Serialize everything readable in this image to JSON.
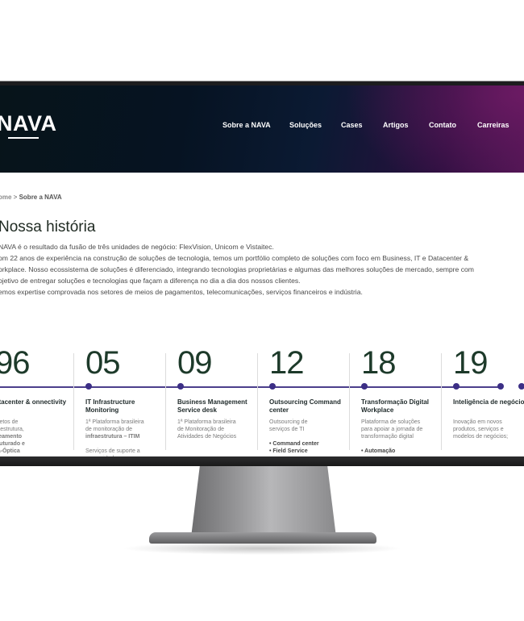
{
  "header": {
    "logo": "NAVA",
    "nav": [
      "Sobre a NAVA",
      "Soluções",
      "Cases",
      "Artigos",
      "Contato",
      "Carreiras"
    ]
  },
  "breadcrumb": {
    "home": "ome",
    "separator": " > ",
    "current": "Sobre a NAVA"
  },
  "page": {
    "title": "Nossa história",
    "intro": [
      "NAVA é o resultado da fusão de três unidades de negócio: FlexVision, Unicom e Vistaitec.",
      "om 22 anos de experiência na construção de soluções de tecnologia, temos um portfólio completo de soluções com foco em Business, IT e Datacenter &",
      "orkplace. Nosso ecossistema de soluções é diferenciado, integrando tecnologias proprietárias e algumas das melhores soluções de mercado, sempre com",
      "ojetivo de entregar soluções e tecnologias que façam a diferença no dia a dia dos nossos clientes.",
      "emos expertise comprovada nos setores de meios de pagamentos, telecomunicações, serviços financeiros e indústria."
    ]
  },
  "timeline": [
    {
      "year": "96",
      "title": "atacenter & onnectivity",
      "desc": [
        "ojetos de",
        "raestrutura,",
        "beamento",
        "truturado e",
        "ra-Óptica"
      ]
    },
    {
      "year": "05",
      "title": "IT Infrastructure Monitoring",
      "desc": [
        "1ª Plataforma brasileira",
        "de monitoração de",
        "infraestrutura – ITIM",
        "",
        "Serviços de suporte a",
        "necessidade"
      ]
    },
    {
      "year": "09",
      "title": "Business Management Service desk",
      "desc": [
        "1ª Plataforma brasileira",
        "de Monitoração de",
        "Atividades de Negócios"
      ]
    },
    {
      "year": "12",
      "title": "Outsourcing Command center",
      "desc": [
        "Outsourcing de",
        "serviços de TI",
        "",
        "• Command center",
        "• Field Service"
      ]
    },
    {
      "year": "18",
      "title": "Transformação Digital Workplace",
      "desc": [
        "Plataforma de soluções",
        "para apoiar a jornada de",
        "transformação digital",
        "",
        "• Automação"
      ]
    },
    {
      "year": "19",
      "title": "Inteligência de negócios",
      "desc": [
        "Inovação em novos",
        "produtos, serviços e",
        "modelos de negócios;"
      ]
    }
  ],
  "colors": {
    "accent": "#3c2f86",
    "heroDark": "#061322",
    "heroMagenta": "#6b1a63",
    "yearText": "#1d3a2a"
  }
}
